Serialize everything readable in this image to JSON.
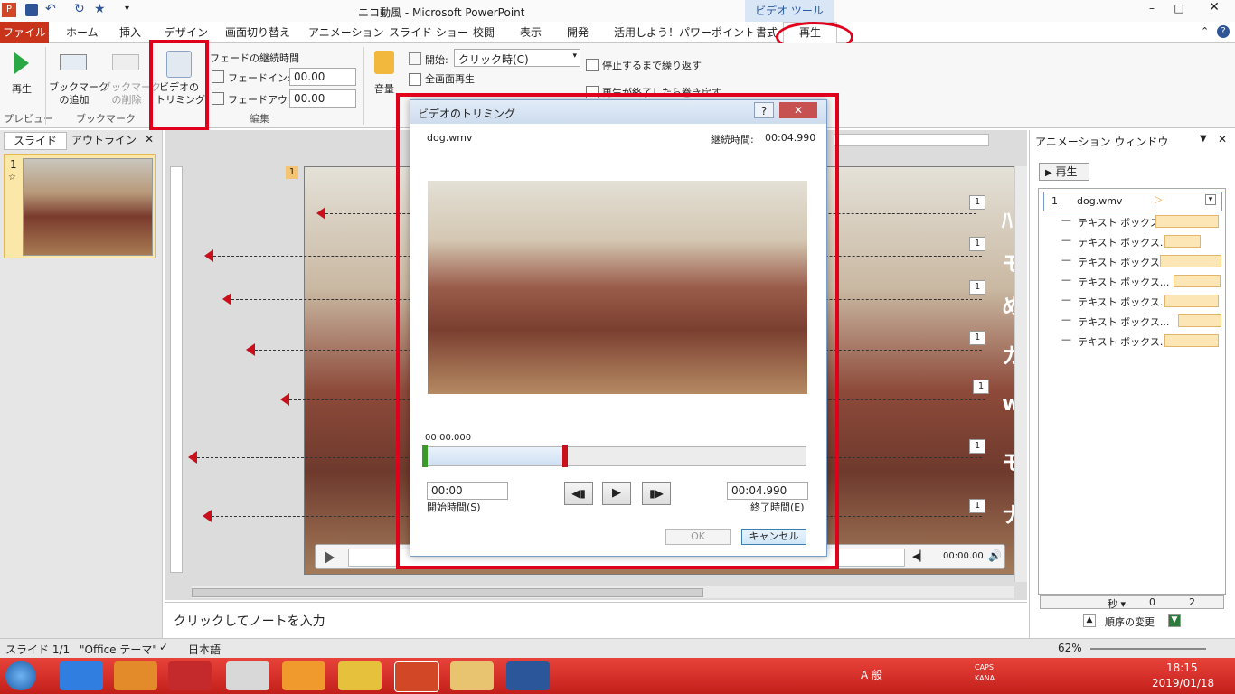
{
  "window": {
    "title": "ニコ動風 - Microsoft PowerPoint",
    "contextual_tab_group": "ビデオ ツール"
  },
  "tabs": [
    "ファイル",
    "ホーム",
    "挿入",
    "デザイン",
    "画面切り替え",
    "アニメーション",
    "スライド ショー",
    "校閲",
    "表示",
    "開発",
    "活用しよう！パワーポイント",
    "書式",
    "再生"
  ],
  "ribbon": {
    "play_label": "再生",
    "group_preview": "プレビュー",
    "add_bookmark": "ブックマーク\nの追加",
    "remove_bookmark": "ブックマーク\nの削除",
    "group_bookmark": "ブックマーク",
    "trim_video": "ビデオの\nトリミング",
    "fade_duration": "フェードの継続時間",
    "fade_in_label": "フェードイン:",
    "fade_in_value": "00.00",
    "fade_out_label": "フェードアウト:",
    "fade_out_value": "00.00",
    "group_edit": "編集",
    "volume_label": "音量",
    "start_label": "開始:",
    "start_value": "クリック時(C)",
    "fullscreen_label": "全画面再生",
    "loop_label": "停止するまで繰り返す",
    "rewind_label": "再生が終了したら巻き戻す"
  },
  "left_panel": {
    "tab_slides": "スライド",
    "tab_outline": "アウトライン",
    "slide_number": "1"
  },
  "notes_placeholder": "クリックしてノートを入力",
  "slide": {
    "badge": "1",
    "media_time": "00:00.00",
    "side_chars": [
      "ﾊ",
      "モ",
      "め",
      "カ",
      "w",
      "モ",
      "ナ"
    ]
  },
  "dialog": {
    "title": "ビデオのトリミング",
    "filename": "dog.wmv",
    "duration_label": "継続時間:",
    "duration_value": "00:04.990",
    "current_time": "00:00.000",
    "start_time_value": "00:00",
    "start_time_label": "開始時間(S)",
    "end_time_value": "00:04.990",
    "end_time_label": "終了時間(E)",
    "ok_label": "OK",
    "cancel_label": "キャンセル",
    "help_label": "?",
    "trim_fraction": 0.37
  },
  "anim_pane": {
    "title": "アニメーション ウィンドウ",
    "play_label": "再生",
    "first_item_num": "1",
    "first_item_name": "dog.wmv",
    "items": [
      "テキスト ボックス...",
      "テキスト ボックス...",
      "テキスト ボックス...",
      "テキスト ボックス...",
      "テキスト ボックス...",
      "テキスト ボックス...",
      "テキスト ボックス..."
    ],
    "seconds_label": "秒",
    "timeline_0": "0",
    "timeline_2": "2",
    "reorder_label": "順序の変更"
  },
  "status": {
    "slide_info": "スライド 1/1",
    "theme": "\"Office テーマ\"",
    "language": "日本語",
    "zoom": "62%"
  },
  "taskbar": {
    "time": "18:15",
    "date": "2019/01/18",
    "caps": "CAPS",
    "kana": "KANA",
    "ime": "A 般"
  }
}
